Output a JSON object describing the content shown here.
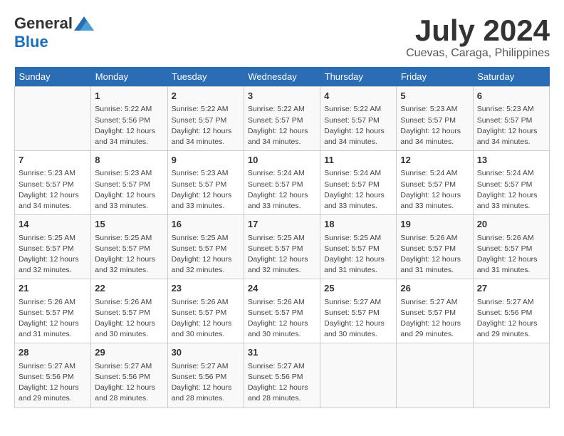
{
  "logo": {
    "general": "General",
    "blue": "Blue"
  },
  "title": "July 2024",
  "location": "Cuevas, Caraga, Philippines",
  "days_header": [
    "Sunday",
    "Monday",
    "Tuesday",
    "Wednesday",
    "Thursday",
    "Friday",
    "Saturday"
  ],
  "weeks": [
    [
      {
        "day": "",
        "info": ""
      },
      {
        "day": "1",
        "info": "Sunrise: 5:22 AM\nSunset: 5:56 PM\nDaylight: 12 hours\nand 34 minutes."
      },
      {
        "day": "2",
        "info": "Sunrise: 5:22 AM\nSunset: 5:57 PM\nDaylight: 12 hours\nand 34 minutes."
      },
      {
        "day": "3",
        "info": "Sunrise: 5:22 AM\nSunset: 5:57 PM\nDaylight: 12 hours\nand 34 minutes."
      },
      {
        "day": "4",
        "info": "Sunrise: 5:22 AM\nSunset: 5:57 PM\nDaylight: 12 hours\nand 34 minutes."
      },
      {
        "day": "5",
        "info": "Sunrise: 5:23 AM\nSunset: 5:57 PM\nDaylight: 12 hours\nand 34 minutes."
      },
      {
        "day": "6",
        "info": "Sunrise: 5:23 AM\nSunset: 5:57 PM\nDaylight: 12 hours\nand 34 minutes."
      }
    ],
    [
      {
        "day": "7",
        "info": "Sunrise: 5:23 AM\nSunset: 5:57 PM\nDaylight: 12 hours\nand 34 minutes."
      },
      {
        "day": "8",
        "info": "Sunrise: 5:23 AM\nSunset: 5:57 PM\nDaylight: 12 hours\nand 33 minutes."
      },
      {
        "day": "9",
        "info": "Sunrise: 5:23 AM\nSunset: 5:57 PM\nDaylight: 12 hours\nand 33 minutes."
      },
      {
        "day": "10",
        "info": "Sunrise: 5:24 AM\nSunset: 5:57 PM\nDaylight: 12 hours\nand 33 minutes."
      },
      {
        "day": "11",
        "info": "Sunrise: 5:24 AM\nSunset: 5:57 PM\nDaylight: 12 hours\nand 33 minutes."
      },
      {
        "day": "12",
        "info": "Sunrise: 5:24 AM\nSunset: 5:57 PM\nDaylight: 12 hours\nand 33 minutes."
      },
      {
        "day": "13",
        "info": "Sunrise: 5:24 AM\nSunset: 5:57 PM\nDaylight: 12 hours\nand 33 minutes."
      }
    ],
    [
      {
        "day": "14",
        "info": "Sunrise: 5:25 AM\nSunset: 5:57 PM\nDaylight: 12 hours\nand 32 minutes."
      },
      {
        "day": "15",
        "info": "Sunrise: 5:25 AM\nSunset: 5:57 PM\nDaylight: 12 hours\nand 32 minutes."
      },
      {
        "day": "16",
        "info": "Sunrise: 5:25 AM\nSunset: 5:57 PM\nDaylight: 12 hours\nand 32 minutes."
      },
      {
        "day": "17",
        "info": "Sunrise: 5:25 AM\nSunset: 5:57 PM\nDaylight: 12 hours\nand 32 minutes."
      },
      {
        "day": "18",
        "info": "Sunrise: 5:25 AM\nSunset: 5:57 PM\nDaylight: 12 hours\nand 31 minutes."
      },
      {
        "day": "19",
        "info": "Sunrise: 5:26 AM\nSunset: 5:57 PM\nDaylight: 12 hours\nand 31 minutes."
      },
      {
        "day": "20",
        "info": "Sunrise: 5:26 AM\nSunset: 5:57 PM\nDaylight: 12 hours\nand 31 minutes."
      }
    ],
    [
      {
        "day": "21",
        "info": "Sunrise: 5:26 AM\nSunset: 5:57 PM\nDaylight: 12 hours\nand 31 minutes."
      },
      {
        "day": "22",
        "info": "Sunrise: 5:26 AM\nSunset: 5:57 PM\nDaylight: 12 hours\nand 30 minutes."
      },
      {
        "day": "23",
        "info": "Sunrise: 5:26 AM\nSunset: 5:57 PM\nDaylight: 12 hours\nand 30 minutes."
      },
      {
        "day": "24",
        "info": "Sunrise: 5:26 AM\nSunset: 5:57 PM\nDaylight: 12 hours\nand 30 minutes."
      },
      {
        "day": "25",
        "info": "Sunrise: 5:27 AM\nSunset: 5:57 PM\nDaylight: 12 hours\nand 30 minutes."
      },
      {
        "day": "26",
        "info": "Sunrise: 5:27 AM\nSunset: 5:57 PM\nDaylight: 12 hours\nand 29 minutes."
      },
      {
        "day": "27",
        "info": "Sunrise: 5:27 AM\nSunset: 5:56 PM\nDaylight: 12 hours\nand 29 minutes."
      }
    ],
    [
      {
        "day": "28",
        "info": "Sunrise: 5:27 AM\nSunset: 5:56 PM\nDaylight: 12 hours\nand 29 minutes."
      },
      {
        "day": "29",
        "info": "Sunrise: 5:27 AM\nSunset: 5:56 PM\nDaylight: 12 hours\nand 28 minutes."
      },
      {
        "day": "30",
        "info": "Sunrise: 5:27 AM\nSunset: 5:56 PM\nDaylight: 12 hours\nand 28 minutes."
      },
      {
        "day": "31",
        "info": "Sunrise: 5:27 AM\nSunset: 5:56 PM\nDaylight: 12 hours\nand 28 minutes."
      },
      {
        "day": "",
        "info": ""
      },
      {
        "day": "",
        "info": ""
      },
      {
        "day": "",
        "info": ""
      }
    ]
  ]
}
